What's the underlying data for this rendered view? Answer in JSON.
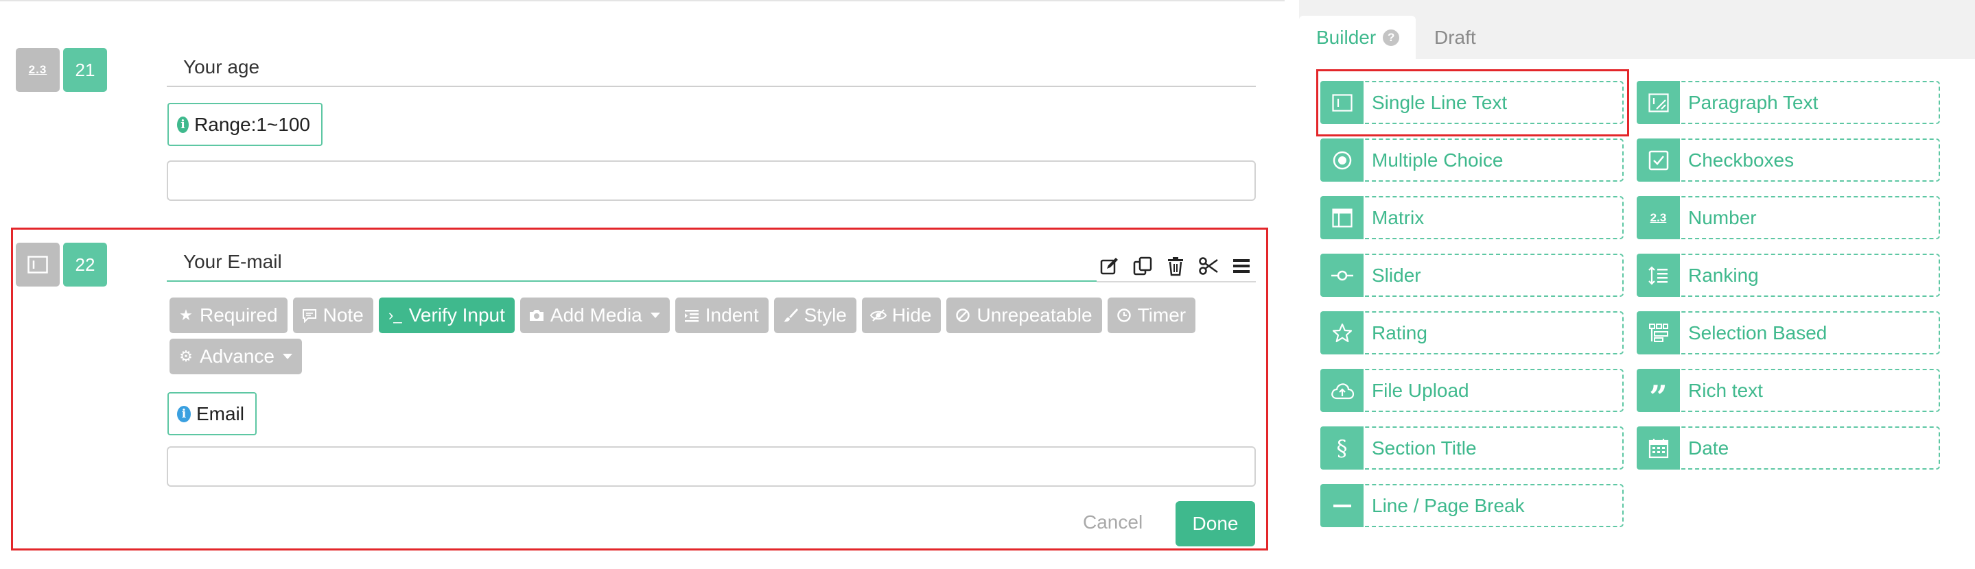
{
  "questions": [
    {
      "type_badge": "2.3",
      "number": "21",
      "title": "Your age",
      "hint": "Range:1~100"
    },
    {
      "number": "22",
      "title": "Your E-mail",
      "hint": "Email",
      "options": [
        {
          "label": "Required",
          "icon": "star-icon",
          "active": false
        },
        {
          "label": "Note",
          "icon": "comment-icon",
          "active": false
        },
        {
          "label": "Verify Input",
          "icon": "terminal-icon",
          "active": true
        },
        {
          "label": "Add Media",
          "icon": "camera-icon",
          "active": false,
          "dropdown": true
        },
        {
          "label": "Indent",
          "icon": "indent-icon",
          "active": false
        },
        {
          "label": "Style",
          "icon": "brush-icon",
          "active": false
        },
        {
          "label": "Hide",
          "icon": "eye-slash-icon",
          "active": false
        },
        {
          "label": "Unrepeatable",
          "icon": "ban-icon",
          "active": false
        },
        {
          "label": "Timer",
          "icon": "clock-icon",
          "active": false
        },
        {
          "label": "Advance",
          "icon": "gear-icon",
          "active": false,
          "dropdown": true
        }
      ],
      "tools": [
        "edit-icon",
        "copy-icon",
        "trash-icon",
        "scissors-icon",
        "menu-icon"
      ],
      "cancel_label": "Cancel",
      "done_label": "Done"
    }
  ],
  "panel": {
    "tabs": [
      {
        "label": "Builder",
        "active": true
      },
      {
        "label": "Draft",
        "active": false
      }
    ],
    "fields": [
      {
        "label": "Single Line Text",
        "icon": "single-line-icon"
      },
      {
        "label": "Paragraph Text",
        "icon": "paragraph-icon"
      },
      {
        "label": "Multiple Choice",
        "icon": "radio-icon"
      },
      {
        "label": "Checkboxes",
        "icon": "checkbox-icon"
      },
      {
        "label": "Matrix",
        "icon": "matrix-icon"
      },
      {
        "label": "Number",
        "icon": "number-icon"
      },
      {
        "label": "Slider",
        "icon": "slider-icon"
      },
      {
        "label": "Ranking",
        "icon": "ranking-icon"
      },
      {
        "label": "Rating",
        "icon": "star-icon"
      },
      {
        "label": "Selection Based",
        "icon": "selection-icon"
      },
      {
        "label": "File Upload",
        "icon": "cloud-upload-icon"
      },
      {
        "label": "Rich text",
        "icon": "quote-icon"
      },
      {
        "label": "Section Title",
        "icon": "section-icon"
      },
      {
        "label": "Date",
        "icon": "calendar-icon"
      },
      {
        "label": "Line / Page Break",
        "icon": "minus-icon"
      }
    ]
  },
  "colors": {
    "accent": "#3fb98d",
    "accent_light": "#5dc7a3",
    "highlight": "#e3262a",
    "chip_inactive": "#c1c1c1"
  }
}
